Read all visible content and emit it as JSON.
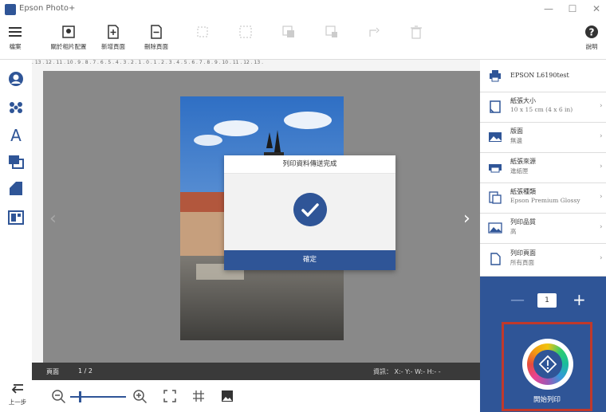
{
  "window": {
    "title": "Epson Photo+",
    "minimize": "—",
    "maximize": "☐",
    "close": "✕"
  },
  "toolbar": {
    "file": "檔案",
    "layout": "關於相片配置",
    "new_page": "新增頁面",
    "delete_page": "刪除頁面",
    "help": "說明"
  },
  "ruler": {
    "top_ticks": ". 13 . 12 . 11 . 10 . 9 . 8 . 7 . 6 . 5 . 4 . 3 . 2 . 1 . 0 . 1 . 2 . 3 . 4 . 5 . 6 . 7 . 8 . 9 . 10 . 11 . 12 . 13 ."
  },
  "dialog": {
    "title": "列印資料傳送完成",
    "ok": "確定"
  },
  "status": {
    "page_label": "頁面",
    "page_num": "1 / 2",
    "info": "資訊：  X:-  Y:-  W:-  H:-  -"
  },
  "bottom": {
    "undo": "上一步"
  },
  "panel": {
    "printer": "EPSON L6190test",
    "settings": [
      {
        "label": "紙張大小",
        "value": "10 x 15 cm (4 x 6 in)"
      },
      {
        "label": "版面",
        "value": "無邊"
      },
      {
        "label": "紙張來源",
        "value": "進紙匣"
      },
      {
        "label": "紙張種類",
        "value": "Epson Premium Glossy"
      },
      {
        "label": "列印品質",
        "value": "高"
      },
      {
        "label": "列印頁面",
        "value": "所有頁面"
      }
    ],
    "quantity": "1",
    "minus": "—",
    "plus": "+",
    "print_label": "開始列印"
  },
  "colors": {
    "accent": "#2f5597",
    "highlight": "#c0392b",
    "canvas": "#898989"
  }
}
